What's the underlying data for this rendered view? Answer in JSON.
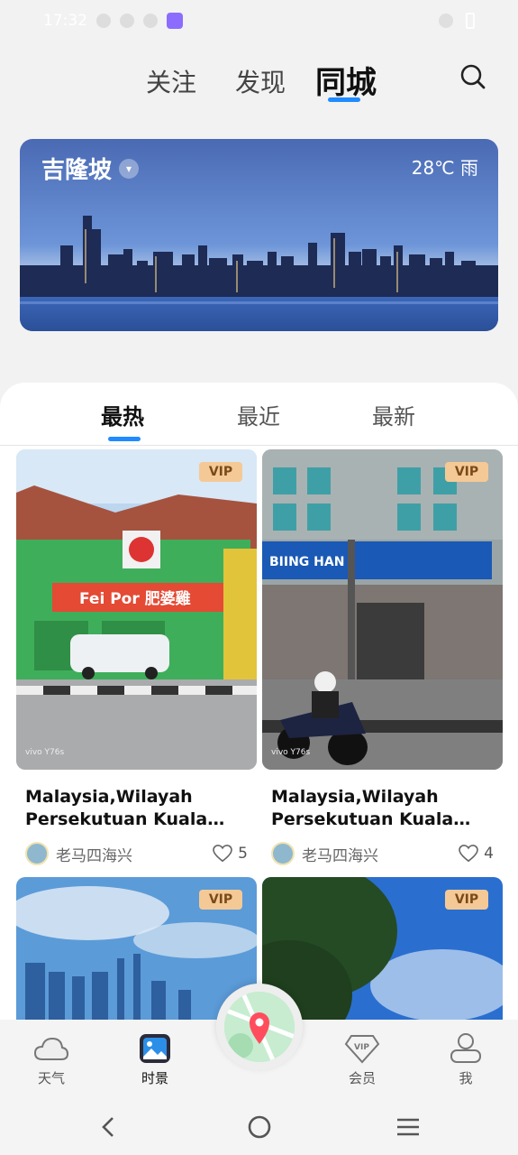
{
  "status_bar": {
    "time": "17:32"
  },
  "top_tabs": [
    {
      "label": "关注"
    },
    {
      "label": "发现"
    },
    {
      "label": "同城"
    }
  ],
  "city_card": {
    "city": "吉隆坡",
    "weather": "28℃ 雨"
  },
  "sub_tabs": [
    {
      "label": "最热"
    },
    {
      "label": "最近"
    },
    {
      "label": "最新"
    }
  ],
  "vip_badge": "VIP",
  "posts": [
    {
      "title": "Malaysia,Wilayah Persekutuan Kuala Lum…",
      "author": "老马四海兴",
      "likes": "5",
      "photo_text": "Fei Por 肥婆雞",
      "watermark": "vivo Y76s"
    },
    {
      "title": "Malaysia,Wilayah Persekutuan Kuala Lum…",
      "author": "老马四海兴",
      "likes": "4",
      "photo_text": "BIING HAN",
      "watermark": "vivo Y76s"
    },
    {
      "title": "",
      "author": "",
      "likes": ""
    },
    {
      "title": "",
      "author": "",
      "likes": ""
    }
  ],
  "bottom_nav": [
    {
      "label": "天气",
      "icon": "cloud-icon"
    },
    {
      "label": "时景",
      "icon": "image-icon"
    },
    {
      "label": "会员",
      "icon": "vip-diamond-icon"
    },
    {
      "label": "我",
      "icon": "user-icon"
    }
  ],
  "colors": {
    "accent": "#1f8bff",
    "vip_bg": "#f5c995"
  }
}
